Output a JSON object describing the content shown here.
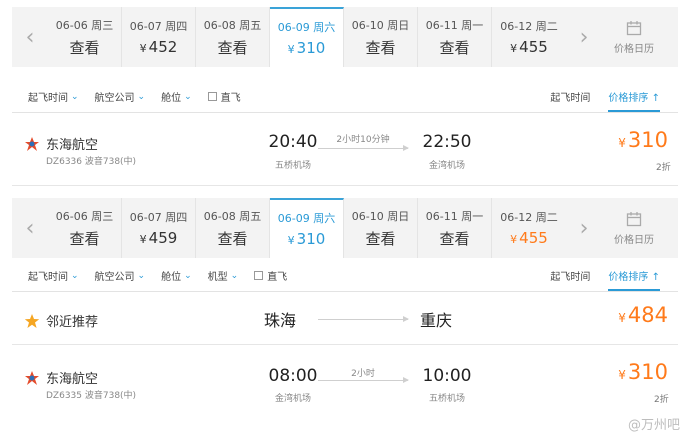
{
  "top": {
    "dates": [
      {
        "date": "06-06 周三",
        "price": "查看",
        "state": "view"
      },
      {
        "date": "06-07 周四",
        "price": "452",
        "state": "price"
      },
      {
        "date": "06-08 周五",
        "price": "查看",
        "state": "view"
      },
      {
        "date": "06-09 周六",
        "price": "310",
        "state": "active"
      },
      {
        "date": "06-10 周日",
        "price": "查看",
        "state": "view"
      },
      {
        "date": "06-11 周一",
        "price": "查看",
        "state": "view"
      },
      {
        "date": "06-12 周二",
        "price": "455",
        "state": "price"
      }
    ],
    "calendar_label": "价格日历",
    "filters": {
      "depart_time": "起飞时间",
      "airline": "航空公司",
      "cabin": "舱位",
      "direct": "直飞"
    },
    "sort": {
      "depart": "起飞时间",
      "price": "价格排序"
    },
    "flight": {
      "airline": "东海航空",
      "flight_no": "DZ6336 波音738(中)",
      "dep_time": "20:40",
      "dep_airport": "五桥机场",
      "duration": "2小时10分钟",
      "arr_time": "22:50",
      "arr_airport": "金湾机场",
      "price": "310",
      "discount": "2折"
    }
  },
  "bottom": {
    "dates": [
      {
        "date": "06-06 周三",
        "price": "查看",
        "state": "view"
      },
      {
        "date": "06-07 周四",
        "price": "459",
        "state": "price"
      },
      {
        "date": "06-08 周五",
        "price": "查看",
        "state": "view"
      },
      {
        "date": "06-09 周六",
        "price": "310",
        "state": "active"
      },
      {
        "date": "06-10 周日",
        "price": "查看",
        "state": "view"
      },
      {
        "date": "06-11 周一",
        "price": "查看",
        "state": "view"
      },
      {
        "date": "06-12 周二",
        "price": "455",
        "state": "highlight"
      }
    ],
    "calendar_label": "价格日历",
    "filters": {
      "depart_time": "起飞时间",
      "airline": "航空公司",
      "cabin": "舱位",
      "aircraft": "机型",
      "direct": "直飞"
    },
    "sort": {
      "depart": "起飞时间",
      "price": "价格排序"
    },
    "nearby": {
      "label": "邻近推荐",
      "from": "珠海",
      "to": "重庆",
      "price": "484"
    },
    "flight": {
      "airline": "东海航空",
      "flight_no": "DZ6335 波音738(中)",
      "dep_time": "08:00",
      "dep_airport": "金湾机场",
      "duration": "2小时",
      "arr_time": "10:00",
      "arr_airport": "五桥机场",
      "price": "310",
      "discount": "2折"
    }
  },
  "currency": "¥",
  "watermark": "@万州吧",
  "colors": {
    "accent": "#2a9ad6",
    "price": "#ff7a1a"
  }
}
